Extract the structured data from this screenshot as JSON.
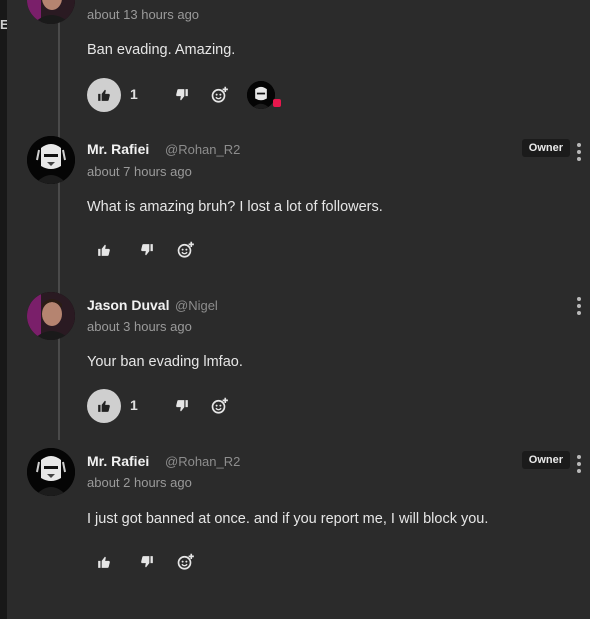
{
  "sidebar": {
    "edge_letter": "E"
  },
  "comments": [
    {
      "author": "",
      "handle": "",
      "time": "about 13 hours ago",
      "text": "Ban evading. Amazing.",
      "likes": "1",
      "liked": true,
      "owner_badge": "",
      "avatar": "man-photo-avatar",
      "reactor_avatar": "masked-figure-avatar"
    },
    {
      "author": "Mr. Rafiei",
      "handle": "@Rohan_R2",
      "time": "about 7 hours ago",
      "text": "What is amazing bruh? I lost a lot of followers.",
      "likes": "",
      "liked": false,
      "owner_badge": "Owner",
      "avatar": "masked-figure-avatar"
    },
    {
      "author": "Jason Duval",
      "handle": "@Nigel",
      "time": "about 3 hours ago",
      "text": "Your ban evading lmfao.",
      "likes": "1",
      "liked": true,
      "owner_badge": "",
      "avatar": "man-photo-avatar"
    },
    {
      "author": "Mr. Rafiei",
      "handle": "@Rohan_R2",
      "time": "about 2 hours ago",
      "text": "I just got banned at once. and if you report me, I will block you.",
      "likes": "",
      "liked": false,
      "owner_badge": "Owner",
      "avatar": "masked-figure-avatar"
    }
  ],
  "colors": {
    "background": "#2b2b2b",
    "like_active": "#cfcfcf",
    "reaction_badge": "#e8174d"
  }
}
